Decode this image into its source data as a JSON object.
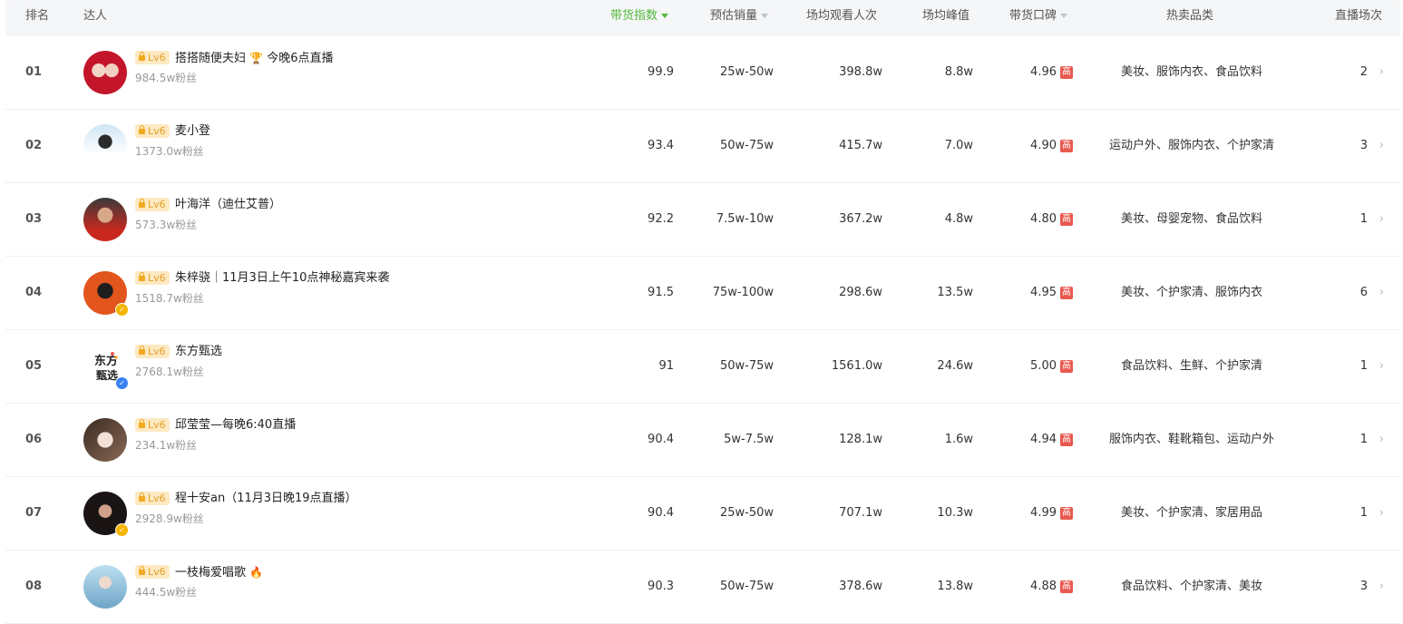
{
  "header": {
    "rank": "排名",
    "creator": "达人",
    "index": "带货指数",
    "sales": "预估销量",
    "viewers": "场均观看人次",
    "peak": "场均峰值",
    "rating": "带货口碑",
    "category": "热卖品类",
    "sessions": "直播场次"
  },
  "rows": [
    {
      "rank": "01",
      "level": "Lv6",
      "name": "搭搭随便夫妇",
      "icon": "trophy-icon",
      "emoji": "🏆",
      "name_suffix": "今晚6点直播",
      "fans": "984.5w粉丝",
      "index": "99.9",
      "sales": "25w-50w",
      "viewers": "398.8w",
      "peak": "8.8w",
      "rating": "4.96",
      "rating_tag": "高",
      "category": "美妆、服饰内衣、食品饮料",
      "sessions": "2"
    },
    {
      "rank": "02",
      "level": "Lv6",
      "name": "麦小登",
      "fans": "1373.0w粉丝",
      "index": "93.4",
      "sales": "50w-75w",
      "viewers": "415.7w",
      "peak": "7.0w",
      "rating": "4.90",
      "rating_tag": "高",
      "category": "运动户外、服饰内衣、个护家清",
      "sessions": "3"
    },
    {
      "rank": "03",
      "level": "Lv6",
      "name": "叶海洋（迪仕艾普）",
      "fans": "573.3w粉丝",
      "index": "92.2",
      "sales": "7.5w-10w",
      "viewers": "367.2w",
      "peak": "4.8w",
      "rating": "4.80",
      "rating_tag": "高",
      "category": "美妆、母婴宠物、食品饮料",
      "sessions": "1"
    },
    {
      "rank": "04",
      "level": "Lv6",
      "name": "朱梓骁｜11月3日上午10点神秘嘉宾来袭",
      "fans": "1518.7w粉丝",
      "verified": "yellow",
      "index": "91.5",
      "sales": "75w-100w",
      "viewers": "298.6w",
      "peak": "13.5w",
      "rating": "4.95",
      "rating_tag": "高",
      "category": "美妆、个护家清、服饰内衣",
      "sessions": "6"
    },
    {
      "rank": "05",
      "level": "Lv6",
      "name": "东方甄选",
      "fans": "2768.1w粉丝",
      "verified": "blue",
      "index": "91",
      "sales": "50w-75w",
      "viewers": "1561.0w",
      "peak": "24.6w",
      "rating": "5.00",
      "rating_tag": "高",
      "category": "食品饮料、生鲜、个护家清",
      "sessions": "1"
    },
    {
      "rank": "06",
      "level": "Lv6",
      "name": "邱莹莹—每晚6:40直播",
      "fans": "234.1w粉丝",
      "index": "90.4",
      "sales": "5w-7.5w",
      "viewers": "128.1w",
      "peak": "1.6w",
      "rating": "4.94",
      "rating_tag": "高",
      "category": "服饰内衣、鞋靴箱包、运动户外",
      "sessions": "1"
    },
    {
      "rank": "07",
      "level": "Lv6",
      "name": "程十安an（11月3日晚19点直播）",
      "fans": "2928.9w粉丝",
      "verified": "yellow",
      "index": "90.4",
      "sales": "25w-50w",
      "viewers": "707.1w",
      "peak": "10.3w",
      "rating": "4.99",
      "rating_tag": "高",
      "category": "美妆、个护家清、家居用品",
      "sessions": "1"
    },
    {
      "rank": "08",
      "level": "Lv6",
      "name": "一枝梅爱唱歌",
      "icon": "fire-icon",
      "emoji": "🔥",
      "fans": "444.5w粉丝",
      "index": "90.3",
      "sales": "50w-75w",
      "viewers": "378.6w",
      "peak": "13.8w",
      "rating": "4.88",
      "rating_tag": "高",
      "category": "食品饮料、个护家清、美妆",
      "sessions": "3"
    }
  ],
  "colors": {
    "accent": "#52b93a",
    "level_bg": "#fde9c2",
    "level_text": "#e3a12a",
    "rating_tag": "#e85a50",
    "verified_blue": "#3b82f6",
    "verified_yellow": "#f5b400"
  }
}
